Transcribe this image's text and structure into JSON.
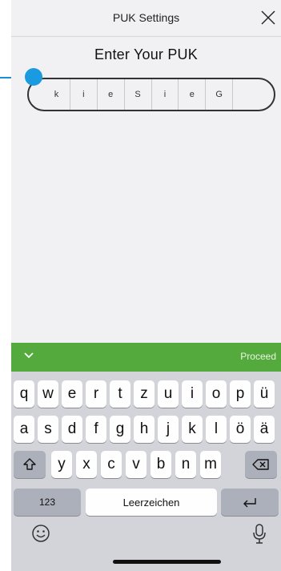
{
  "header": {
    "title": "PUK Settings"
  },
  "heading": "Enter Your PUK",
  "puk_cells": [
    "k",
    "i",
    "e",
    "S",
    "i",
    "e",
    "G",
    ""
  ],
  "accessory": {
    "proceed_label": "Proceed"
  },
  "keyboard": {
    "row1": [
      "q",
      "w",
      "e",
      "r",
      "t",
      "z",
      "u",
      "i",
      "o",
      "p",
      "ü"
    ],
    "row2": [
      "a",
      "s",
      "d",
      "f",
      "g",
      "h",
      "j",
      "k",
      "l",
      "ö",
      "ä"
    ],
    "row3": [
      "y",
      "x",
      "c",
      "v",
      "b",
      "n",
      "m"
    ],
    "numbers_label": "123",
    "space_label": "Leerzeichen"
  },
  "colors": {
    "accent_green": "#55aa3d",
    "indicator_blue": "#1a9ae0"
  },
  "icons": [
    "close-icon",
    "chevron-down-icon",
    "shift-icon",
    "backspace-icon",
    "return-icon",
    "emoji-icon",
    "microphone-icon"
  ]
}
